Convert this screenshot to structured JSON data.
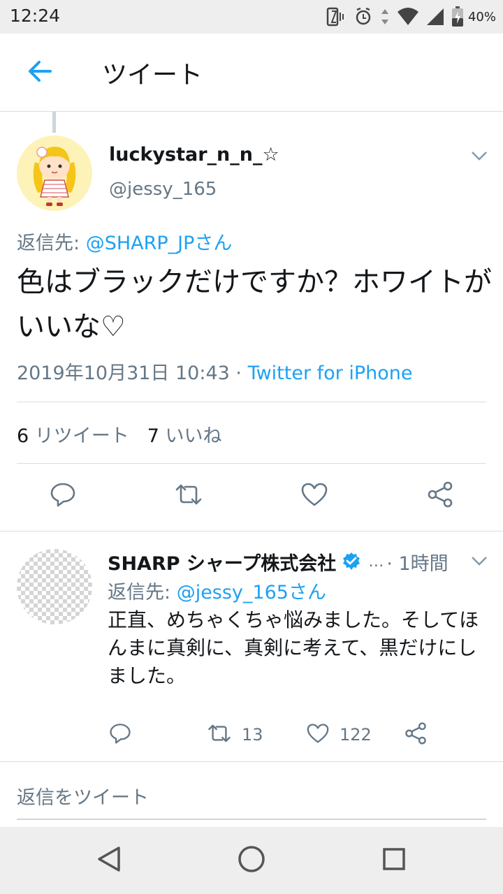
{
  "status_bar": {
    "time": "12:24",
    "battery": "40%",
    "icons": [
      "vibrate-icon",
      "alarm-icon",
      "data-arrows-icon",
      "wifi-icon",
      "signal-icon",
      "battery-icon"
    ]
  },
  "header": {
    "title": "ツイート",
    "back_icon": "arrow-left-icon"
  },
  "tweet": {
    "author_name": "luckystar_n_n_☆",
    "author_handle": "@jessy_165",
    "reply_label": "返信先: ",
    "reply_mention": "@SHARP_JPさん",
    "text": "色はブラックだけですか？ホワイトがいいな♡",
    "timestamp": "2019年10月31日 10:43 · ",
    "source": "Twitter for iPhone",
    "retweet_count": "6",
    "retweet_label": " リツイート",
    "like_count": "7",
    "like_label": " いいね"
  },
  "reply": {
    "author_name": "SHARP シャープ株式会社",
    "ellipsis": "…",
    "time": "· 1時間",
    "reply_label": "返信先: ",
    "reply_mention": "@jessy_165さん",
    "text": "正直、めちゃくちゃ悩みました。そしてほんまに真剣に、真剣に考えて、黒だけにしました。",
    "retweet_count": "13",
    "like_count": "122"
  },
  "composer": {
    "placeholder": "返信をツイート"
  },
  "colors": {
    "accent": "#1da1f2",
    "secondary_text": "#657786",
    "divider": "#d8dde1",
    "verified": "#1da1f2"
  }
}
